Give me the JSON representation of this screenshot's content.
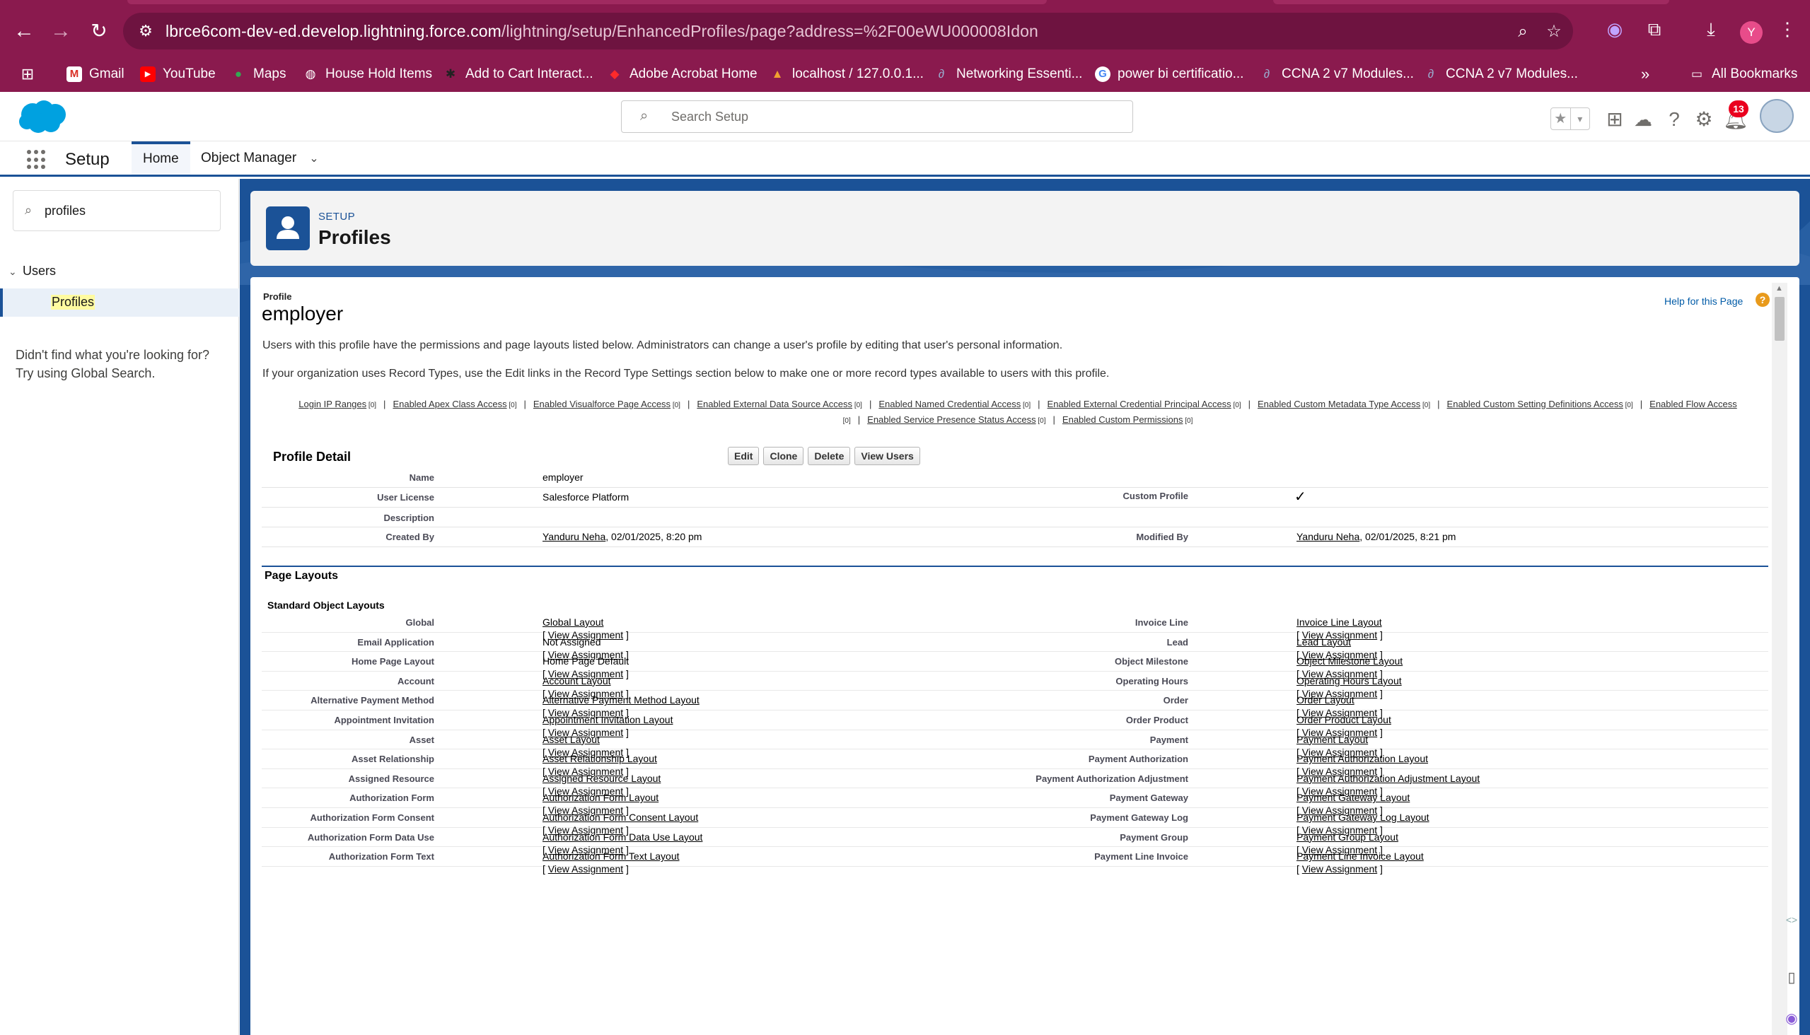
{
  "browser": {
    "url_host": "lbrce6com-dev-ed.develop.lightning.force.com",
    "url_path": "/lightning/setup/EnhancedProfiles/page?address=%2F00eWU000008Idon",
    "profile_initial": "Y",
    "bookmarks": [
      "Gmail",
      "YouTube",
      "Maps",
      "House Hold Items",
      "Add to Cart Interact...",
      "Adobe Acrobat Home",
      "localhost / 127.0.0.1...",
      "Networking Essenti...",
      "power bi certificatio...",
      "CCNA 2 v7 Modules...",
      "CCNA 2 v7 Modules..."
    ],
    "overflow": "»",
    "all_bookmarks": "All Bookmarks"
  },
  "header": {
    "search_placeholder": "Search Setup",
    "notification_count": "13",
    "app_name": "Setup",
    "tabs": [
      "Home",
      "Object Manager"
    ]
  },
  "sidebar": {
    "quick_find": "profiles",
    "group": "Users",
    "item": "Profiles",
    "help_line1": "Didn't find what you're looking for?",
    "help_line2": "Try using Global Search."
  },
  "page_header": {
    "sup": "SETUP",
    "title": "Profiles"
  },
  "profile": {
    "label": "Profile",
    "name": "employer",
    "help_link": "Help for this Page",
    "help_badge": "?",
    "desc1": "Users with this profile have the permissions and page layouts listed below. Administrators can change a user's profile by editing that user's personal information.",
    "desc2": "If your organization uses Record Types, use the Edit links in the Record Type Settings section below to make one or more record types available to users with this profile.",
    "related_links": [
      "Login IP Ranges",
      "Enabled Apex Class Access",
      "Enabled Visualforce Page Access",
      "Enabled External Data Source Access",
      "Enabled Named Credential Access",
      "Enabled External Credential Principal Access",
      "Enabled Custom Metadata Type Access",
      "Enabled Custom Setting Definitions Access",
      "Enabled Flow Access",
      "Enabled Service Presence Status Access",
      "Enabled Custom Permissions"
    ],
    "link_count": "[0]"
  },
  "detail": {
    "title": "Profile Detail",
    "buttons": [
      "Edit",
      "Clone",
      "Delete",
      "View Users"
    ],
    "name_label": "Name",
    "name_value": "employer",
    "license_label": "User License",
    "license_value": "Salesforce Platform",
    "custom_label": "Custom Profile",
    "custom_check": "✓",
    "description_label": "Description",
    "created_label": "Created By",
    "created_user": "Yanduru Neha",
    "created_date": ", 02/01/2025, 8:20 pm",
    "modified_label": "Modified By",
    "modified_user": "Yanduru Neha",
    "modified_date": ", 02/01/2025, 8:21 pm"
  },
  "layouts": {
    "title": "Page Layouts",
    "subtitle": "Standard Object Layouts",
    "view_assignment": "View Assignment",
    "rows": [
      {
        "l": "Global",
        "v": "Global Layout",
        "link": true,
        "l2": "Invoice Line",
        "v2": "Invoice Line Layout"
      },
      {
        "l": "Email Application",
        "v": "Not Assigned",
        "link": false,
        "l2": "Lead",
        "v2": "Lead Layout"
      },
      {
        "l": "Home Page Layout",
        "v": "Home Page Default",
        "link": false,
        "l2": "Object Milestone",
        "v2": "Object Milestone Layout"
      },
      {
        "l": "Account",
        "v": "Account Layout",
        "link": true,
        "l2": "Operating Hours",
        "v2": "Operating Hours Layout"
      },
      {
        "l": "Alternative Payment Method",
        "v": "Alternative Payment Method Layout",
        "link": true,
        "l2": "Order",
        "v2": "Order Layout"
      },
      {
        "l": "Appointment Invitation",
        "v": "Appointment Invitation Layout",
        "link": true,
        "l2": "Order Product",
        "v2": "Order Product Layout"
      },
      {
        "l": "Asset",
        "v": "Asset Layout",
        "link": true,
        "l2": "Payment",
        "v2": "Payment Layout"
      },
      {
        "l": "Asset Relationship",
        "v": "Asset Relationship Layout",
        "link": true,
        "l2": "Payment Authorization",
        "v2": "Payment Authorization Layout"
      },
      {
        "l": "Assigned Resource",
        "v": "Assigned Resource Layout",
        "link": true,
        "l2": "Payment Authorization Adjustment",
        "v2": "Payment Authorization Adjustment Layout"
      },
      {
        "l": "Authorization Form",
        "v": "Authorization Form Layout",
        "link": true,
        "l2": "Payment Gateway",
        "v2": "Payment Gateway Layout"
      },
      {
        "l": "Authorization Form Consent",
        "v": "Authorization Form Consent Layout",
        "link": true,
        "l2": "Payment Gateway Log",
        "v2": "Payment Gateway Log Layout"
      },
      {
        "l": "Authorization Form Data Use",
        "v": "Authorization Form Data Use Layout",
        "link": true,
        "l2": "Payment Group",
        "v2": "Payment Group Layout"
      },
      {
        "l": "Authorization Form Text",
        "v": "Authorization Form Text Layout",
        "link": true,
        "l2": "Payment Line Invoice",
        "v2": "Payment Line Invoice Layout"
      }
    ]
  },
  "colors": {
    "chrome": "#8a1a4e",
    "brand": "#1b5297",
    "link": "#015ba7"
  }
}
